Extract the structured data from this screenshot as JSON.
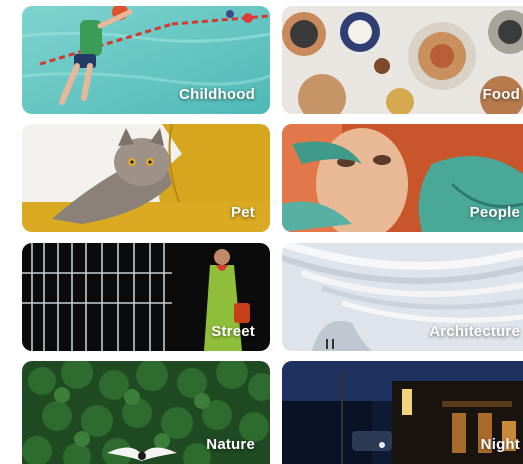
{
  "categories": [
    {
      "label": "Childhood",
      "icon": "childhood-photo"
    },
    {
      "label": "Food",
      "icon": "food-photo"
    },
    {
      "label": "Pet",
      "icon": "pet-photo"
    },
    {
      "label": "People",
      "icon": "people-photo"
    },
    {
      "label": "Street",
      "icon": "street-photo"
    },
    {
      "label": "Architecture",
      "icon": "architecture-photo"
    },
    {
      "label": "Nature",
      "icon": "nature-photo"
    },
    {
      "label": "Night",
      "icon": "night-photo"
    }
  ]
}
